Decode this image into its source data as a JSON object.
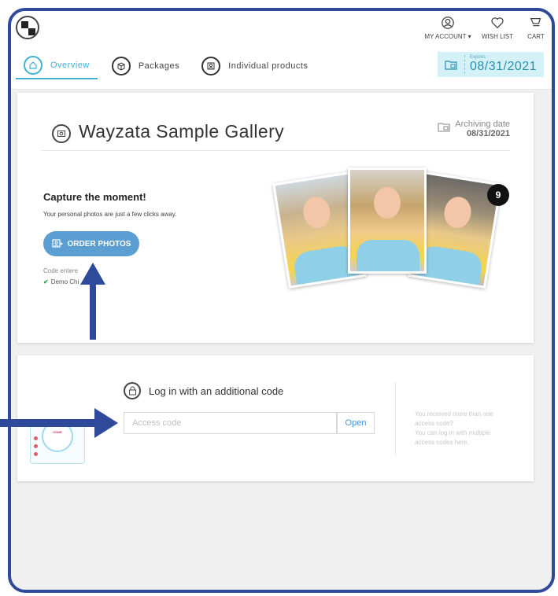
{
  "header": {
    "account_label": "MY ACCOUNT",
    "account_caret": "▾",
    "wishlist_label": "WISH LIST",
    "cart_label": "CART",
    "tabs": [
      {
        "label": "Overview"
      },
      {
        "label": "Packages"
      },
      {
        "label": "Individual products"
      }
    ],
    "expires": {
      "label": "Expires",
      "date": "08/31/2021"
    }
  },
  "gallery": {
    "title": "Wayzata Sample Gallery",
    "archive_label": "Archiving date",
    "archive_date": "08/31/2021"
  },
  "capture": {
    "title": "Capture the moment!",
    "subtitle": "Your personal photos are just a few clicks away.",
    "order_button": "ORDER PHOTOS",
    "code_entered": "Code entere",
    "code_name": "Demo Chi",
    "photo_count": "9"
  },
  "login": {
    "title": "Log in with an additional code",
    "placeholder": "Access code",
    "open_button": "Open",
    "help_lines": [
      "You received more than one",
      "access code?",
      "You can log in with multiple",
      "access codes here."
    ],
    "illustration_text": "CODE"
  },
  "colors": {
    "frame": "#2f4a9a",
    "accent": "#3fb0d6",
    "button": "#5b9ed2",
    "arrow": "#2f4a9a"
  }
}
